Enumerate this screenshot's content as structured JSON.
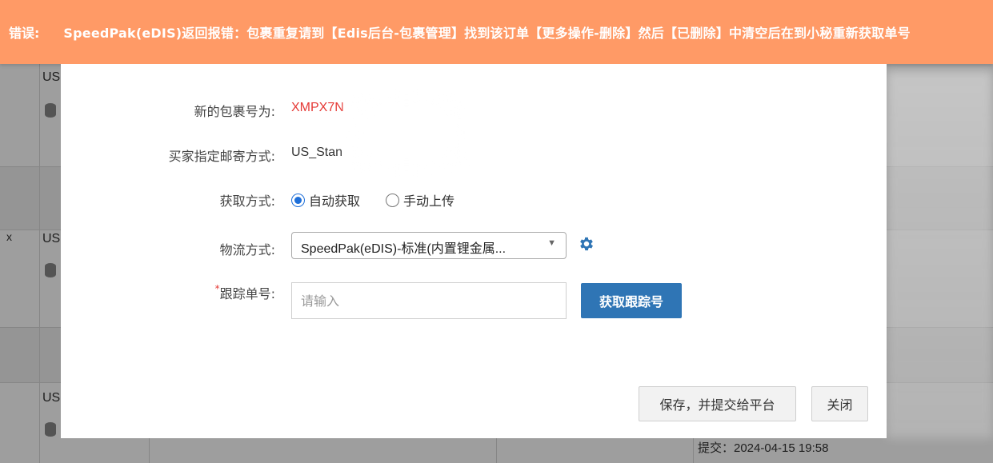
{
  "banner": {
    "label": "错误:",
    "message": "SpeedPak(eDIS)返回报错：包裹重复请到【Edis后台-包裹管理】找到该订单【更多操作-删除】然后【已删除】中清空后在到小秘重新获取单号"
  },
  "background": {
    "row_markers": [
      "US",
      "US",
      "US"
    ],
    "x_marker": "x",
    "submit_text": "提交：2024-04-15 19:58"
  },
  "dialog": {
    "package_no": {
      "label": "新的包裹号为:",
      "value": "XMPX7N"
    },
    "buyer_method": {
      "label": "买家指定邮寄方式:",
      "value": "US_Stan"
    },
    "fetch_mode": {
      "label": "获取方式:",
      "options": [
        {
          "label": "自动获取",
          "checked": true
        },
        {
          "label": "手动上传",
          "checked": false
        }
      ]
    },
    "logistics": {
      "label": "物流方式:",
      "selected": "SpeedPak(eDIS)-标准(内置锂金属...",
      "settings_icon": "gear-icon"
    },
    "tracking": {
      "required_mark": "*",
      "label": "跟踪单号:",
      "placeholder": "请输入",
      "value": "",
      "fetch_button": "获取跟踪号"
    },
    "footer": {
      "save_button": "保存，并提交给平台",
      "close_button": "关闭"
    }
  },
  "colors": {
    "banner_bg": "#ff9a66",
    "accent": "#1e6fd9",
    "primary_button": "#2f75b5",
    "error_text": "#e53935"
  }
}
